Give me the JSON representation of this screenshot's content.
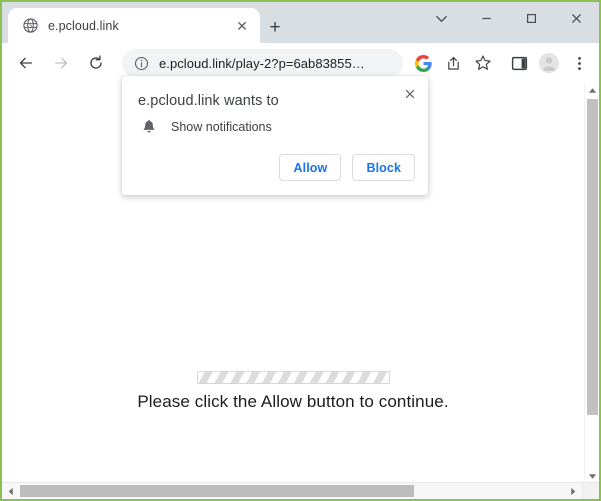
{
  "window": {
    "border_color": "#8cbf54",
    "chrome_bg": "#d9dee2",
    "controls": {
      "chevron_down": "⌄",
      "minimize": "–",
      "maximize": "□",
      "close": "✕"
    }
  },
  "tabstrip": {
    "tab": {
      "favicon": "globe-icon",
      "title": "e.pcloud.link",
      "close_label": "✕"
    },
    "new_tab_label": "+"
  },
  "toolbar": {
    "back_label": "←",
    "forward_label": "→",
    "reload_label": "⟳",
    "omnibox": {
      "security_icon": "info-circle-icon",
      "url": "e.pcloud.link/play-2?p=6ab83855…"
    },
    "icons": [
      {
        "name": "google-lens-icon",
        "label": "G"
      },
      {
        "name": "share-icon",
        "label": "share"
      },
      {
        "name": "bookmark-star-icon",
        "label": "☆"
      },
      {
        "name": "side-panel-icon",
        "label": "panel"
      },
      {
        "name": "profile-avatar-icon",
        "label": "avatar"
      },
      {
        "name": "more-menu-icon",
        "label": "⋮"
      }
    ]
  },
  "dialog": {
    "title": "e.pcloud.link wants to",
    "permission_icon": "bell-icon",
    "permission_label": "Show notifications",
    "allow_label": "Allow",
    "block_label": "Block",
    "close_label": "✕",
    "accent_color": "#1a73e8"
  },
  "page": {
    "progress_label": "striped-progress-bar",
    "message": "Please click the Allow button to continue."
  },
  "scrollbars": {
    "vertical_up": "▲",
    "vertical_down": "▼",
    "horizontal_left": "◀",
    "horizontal_right": "▶"
  }
}
